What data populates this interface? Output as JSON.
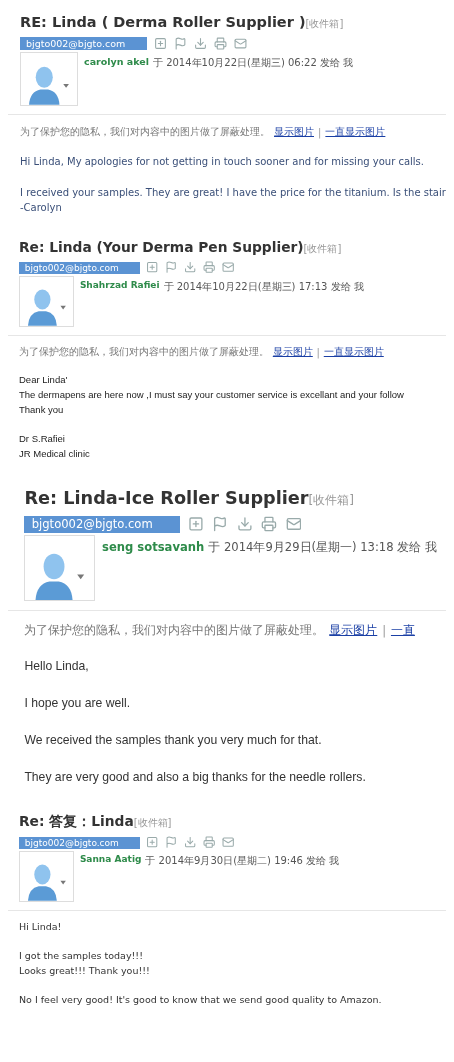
{
  "emails": [
    {
      "subject": "RE: Linda ( Derma Roller Supplier )",
      "folder": "[收件箱]",
      "account": "bjgto002@bjgto.com",
      "sender": "carolyn akel",
      "meta": "于 2014年10月22日(星期三) 06:22 发给 我",
      "notice": {
        "text": "为了保护您的隐私，我们对内容中的图片做了屏蔽处理。",
        "links": [
          "显示图片",
          "一直显示图片"
        ],
        "separator": "|"
      },
      "paragraphs": [
        [
          "Hi Linda, My apologies for not getting in touch sooner and for missing your calls."
        ],
        [
          "I received your samples. They are great!  I have the price for the titanium. Is the stair",
          "-Carolyn"
        ]
      ]
    },
    {
      "subject": "Re: Linda (Your Derma Pen Supplier)",
      "folder": "[收件箱]",
      "account": "bjgto002@bjgto.com",
      "sender": "Shahrzad Rafiei",
      "meta": "于 2014年10月22日(星期三) 17:13 发给 我",
      "notice": {
        "text": "为了保护您的隐私，我们对内容中的图片做了屏蔽处理。",
        "links": [
          "显示图片",
          "一直显示图片"
        ],
        "separator": "|"
      },
      "paragraphs": [
        [
          "Dear Linda'",
          "The dermapens are here now ,I must say your customer service is excellant and your follow",
          "Thank you"
        ],
        [
          "Dr S.Rafiei",
          "JR Medical clinic"
        ]
      ]
    },
    {
      "subject": "Re: Linda-Ice Roller Supplier",
      "folder": "[收件箱]",
      "account": "bjgto002@bjgto.com",
      "sender": "seng sotsavanh",
      "meta": "于 2014年9月29日(星期一) 13:18 发给 我",
      "notice": {
        "text": "为了保护您的隐私，我们对内容中的图片做了屏蔽处理。",
        "links": [
          "显示图片",
          "一直"
        ],
        "separator": "|"
      },
      "paragraphs": [
        [
          "Hello Linda,"
        ],
        [
          "I hope you are well."
        ],
        [
          "We received the samples thank you very much for that."
        ],
        [
          "They are very good and also a big thanks for the needle rollers."
        ]
      ]
    },
    {
      "subject": "Re: 答复：Linda",
      "folder": "[收件箱]",
      "account": "bjgto002@bjgto.com",
      "sender": "Sanna Aatig",
      "meta": "于 2014年9月30日(星期二) 19:46 发给 我",
      "paragraphs": [
        [
          "Hi Linda!"
        ],
        [
          "I got the samples today!!!",
          "Looks great!!! Thank you!!!"
        ],
        [
          "No I feel very good! It's good to know that we send good quality to Amazon."
        ]
      ]
    }
  ]
}
